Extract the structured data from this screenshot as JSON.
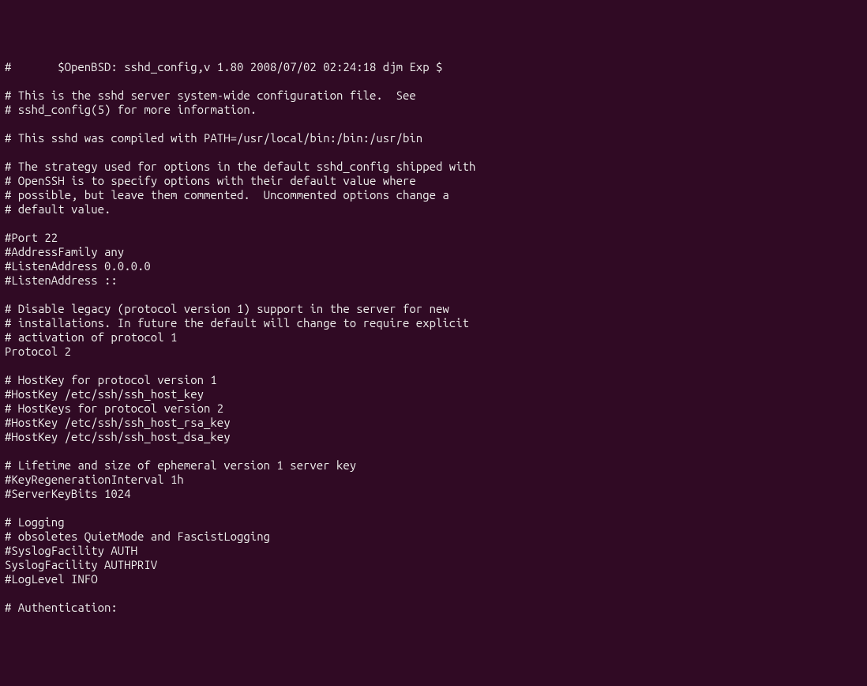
{
  "lines": [
    "#       $OpenBSD: sshd_config,v 1.80 2008/07/02 02:24:18 djm Exp $",
    "",
    "# This is the sshd server system-wide configuration file.  See",
    "# sshd_config(5) for more information.",
    "",
    "# This sshd was compiled with PATH=/usr/local/bin:/bin:/usr/bin",
    "",
    "# The strategy used for options in the default sshd_config shipped with",
    "# OpenSSH is to specify options with their default value where",
    "# possible, but leave them commented.  Uncommented options change a",
    "# default value.",
    "",
    "#Port 22",
    "#AddressFamily any",
    "#ListenAddress 0.0.0.0",
    "#ListenAddress ::",
    "",
    "# Disable legacy (protocol version 1) support in the server for new",
    "# installations. In future the default will change to require explicit",
    "# activation of protocol 1",
    "Protocol 2",
    "",
    "# HostKey for protocol version 1",
    "#HostKey /etc/ssh/ssh_host_key",
    "# HostKeys for protocol version 2",
    "#HostKey /etc/ssh/ssh_host_rsa_key",
    "#HostKey /etc/ssh/ssh_host_dsa_key",
    "",
    "# Lifetime and size of ephemeral version 1 server key",
    "#KeyRegenerationInterval 1h",
    "#ServerKeyBits 1024",
    "",
    "# Logging",
    "# obsoletes QuietMode and FascistLogging",
    "#SyslogFacility AUTH",
    "SyslogFacility AUTHPRIV",
    "#LogLevel INFO",
    "",
    "# Authentication:"
  ]
}
